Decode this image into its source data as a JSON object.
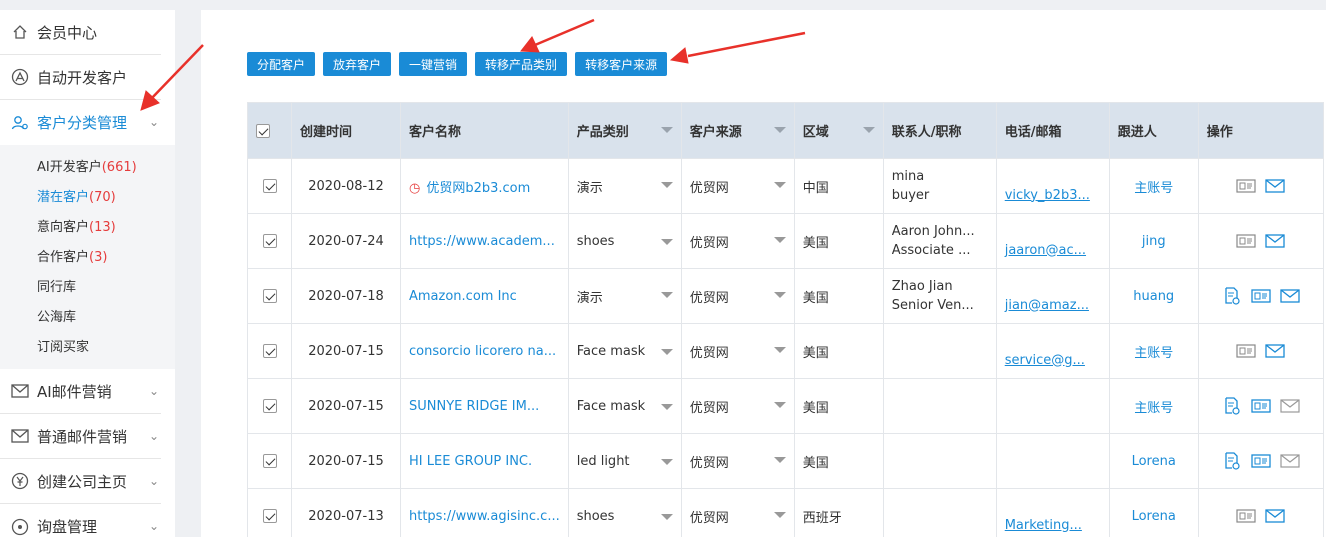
{
  "sidebar": {
    "items_top": [
      {
        "label": "会员中心",
        "icon": "home-icon"
      },
      {
        "label": "自动开发客户",
        "icon": "auto-develop-icon"
      },
      {
        "label": "客户分类管理",
        "icon": "customer-category-icon",
        "active": true
      }
    ],
    "submenu": [
      {
        "label": "AI开发客户",
        "count": "(661)"
      },
      {
        "label": "潜在客户",
        "count": "(70)",
        "active": true
      },
      {
        "label": "意向客户",
        "count": "(13)"
      },
      {
        "label": "合作客户",
        "count": "(3)"
      },
      {
        "label": "同行库",
        "count": ""
      },
      {
        "label": "公海库",
        "count": ""
      },
      {
        "label": "订阅买家",
        "count": ""
      }
    ],
    "items_bottom": [
      {
        "label": "AI邮件营销",
        "icon": "ai-mail-icon"
      },
      {
        "label": "普通邮件营销",
        "icon": "mail-icon"
      },
      {
        "label": "创建公司主页",
        "icon": "yen-icon"
      },
      {
        "label": "询盘管理",
        "icon": "inquiry-icon"
      }
    ]
  },
  "toolbar": {
    "buttons": [
      "分配客户",
      "放弃客户",
      "一键营销",
      "转移产品类别",
      "转移客户来源"
    ]
  },
  "table": {
    "headers": {
      "created": "创建时间",
      "name": "客户名称",
      "category": "产品类别",
      "source": "客户来源",
      "region": "区域",
      "contact": "联系人/职称",
      "phone": "电话/邮箱",
      "follower": "跟进人",
      "ops": "操作"
    },
    "rows": [
      {
        "date": "2020-08-12",
        "name": "优贸网b2b3.com",
        "clock": true,
        "category": "演示",
        "source": "优贸网",
        "region": "中国",
        "contact1": "mina",
        "contact2": "buyer",
        "email": "vicky_b2b3...",
        "follower": "主账号",
        "ops": [
          "card",
          "mail"
        ]
      },
      {
        "date": "2020-07-24",
        "name": "https://www.academ...",
        "clock": false,
        "category": "shoes",
        "source": "优贸网",
        "region": "美国",
        "contact1": "Aaron John...",
        "contact2": "Associate ...",
        "email": "jaaron@ac...",
        "follower": "jing",
        "ops": [
          "card",
          "mail"
        ]
      },
      {
        "date": "2020-07-18",
        "name": "Amazon.com Inc",
        "clock": false,
        "category": "演示",
        "source": "优贸网",
        "region": "美国",
        "contact1": "Zhao Jian",
        "contact2": "Senior Ven...",
        "email": "jian@amaz...",
        "follower": "huang",
        "ops": [
          "doc",
          "card",
          "mail"
        ]
      },
      {
        "date": "2020-07-15",
        "name": "consorcio licorero na...",
        "clock": false,
        "category": "Face mask",
        "source": "优贸网",
        "region": "美国",
        "contact1": "",
        "contact2": "",
        "email": "service@g...",
        "follower": "主账号",
        "ops": [
          "card",
          "mail"
        ]
      },
      {
        "date": "2020-07-15",
        "name": "SUNNYE RIDGE IM...",
        "clock": false,
        "category": "Face mask",
        "source": "优贸网",
        "region": "美国",
        "contact1": "",
        "contact2": "",
        "email": "",
        "follower": "主账号",
        "ops": [
          "doc",
          "card",
          "mail-gray"
        ]
      },
      {
        "date": "2020-07-15",
        "name": "HI LEE GROUP INC.",
        "clock": false,
        "category": "led light",
        "source": "优贸网",
        "region": "美国",
        "contact1": "",
        "contact2": "",
        "email": "",
        "follower": "Lorena",
        "ops": [
          "doc",
          "card",
          "mail-gray"
        ]
      },
      {
        "date": "2020-07-13",
        "name": "https://www.agisinc.c...",
        "clock": false,
        "category": "shoes",
        "source": "优贸网",
        "region": "西班牙",
        "contact1": "",
        "contact2": "",
        "email": "Marketing...",
        "follower": "Lorena",
        "ops": [
          "card",
          "mail"
        ]
      }
    ]
  },
  "colors": {
    "accent": "#1a8bd6",
    "count": "#e53c3c",
    "arrow": "#e8312a",
    "header_bg": "#d9e2ec"
  }
}
